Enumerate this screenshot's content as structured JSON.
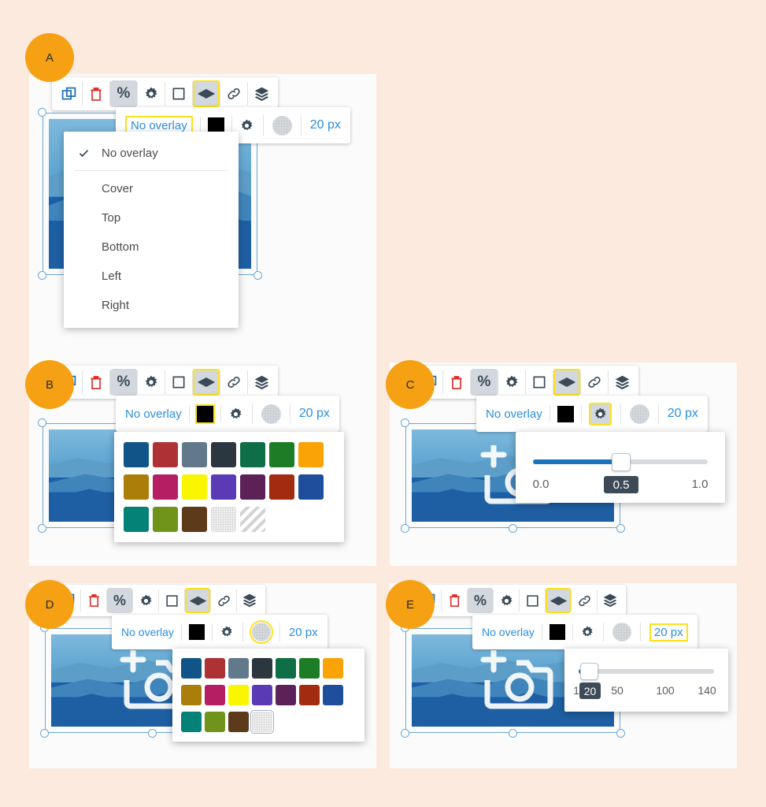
{
  "background_color": "#fdeade",
  "badges": [
    "A",
    "B",
    "C",
    "D",
    "E"
  ],
  "toolbar": {
    "icons": [
      {
        "name": "duplicate-icon",
        "glyph": "duplicate"
      },
      {
        "name": "delete-icon",
        "glyph": "trash"
      },
      {
        "name": "percent-icon",
        "glyph": "percent"
      },
      {
        "name": "settings-gear-icon",
        "glyph": "gear"
      },
      {
        "name": "border-square-icon",
        "glyph": "square"
      },
      {
        "name": "overlay-diamond-icon",
        "glyph": "diamond"
      },
      {
        "name": "link-icon",
        "glyph": "link"
      },
      {
        "name": "layers-icon",
        "glyph": "layers"
      }
    ]
  },
  "overlay_bar": {
    "overlay_label": "No overlay",
    "color_value": "#000000",
    "opacity_icon": "gear-icon",
    "blur_icon": "blur-circle-icon",
    "blur_value": "20 px"
  },
  "overlay_menu": {
    "items": [
      {
        "label": "No overlay",
        "checked": true
      },
      {
        "label": "Cover",
        "checked": false
      },
      {
        "label": "Top",
        "checked": false
      },
      {
        "label": "Bottom",
        "checked": false
      },
      {
        "label": "Left",
        "checked": false
      },
      {
        "label": "Right",
        "checked": false
      }
    ]
  },
  "palette_full": {
    "columns": 7,
    "swatches": [
      {
        "name": "blue-dark",
        "color": "#115588"
      },
      {
        "name": "red-brick",
        "color": "#ae3135"
      },
      {
        "name": "slate-gray",
        "color": "#62798c"
      },
      {
        "name": "charcoal",
        "color": "#2c363f"
      },
      {
        "name": "green-sea",
        "color": "#0e6e46"
      },
      {
        "name": "green-forest",
        "color": "#1d7d27"
      },
      {
        "name": "orange",
        "color": "#faa307"
      },
      {
        "name": "gold-dark",
        "color": "#ab7e09"
      },
      {
        "name": "magenta",
        "color": "#b51e62"
      },
      {
        "name": "yellow",
        "color": "#faf500"
      },
      {
        "name": "purple",
        "color": "#5b3bb5"
      },
      {
        "name": "plum",
        "color": "#5c2157"
      },
      {
        "name": "rust",
        "color": "#a32b0f"
      },
      {
        "name": "blue-royal",
        "color": "#1f4f9c"
      },
      {
        "name": "teal",
        "color": "#048278"
      },
      {
        "name": "olive",
        "color": "#6f9419"
      },
      {
        "name": "brown",
        "color": "#5d3a1a"
      },
      {
        "name": "transparent",
        "color": "transparent"
      },
      {
        "name": "no-color-diagonal",
        "color": "none"
      }
    ]
  },
  "palette_blur": {
    "columns": 7,
    "swatches": [
      {
        "name": "blue-dark",
        "color": "#115588"
      },
      {
        "name": "red-brick",
        "color": "#ae3135"
      },
      {
        "name": "slate-gray",
        "color": "#62798c"
      },
      {
        "name": "charcoal",
        "color": "#2c363f"
      },
      {
        "name": "green-sea",
        "color": "#0e6e46"
      },
      {
        "name": "green-forest",
        "color": "#1d7d27"
      },
      {
        "name": "orange",
        "color": "#faa307"
      },
      {
        "name": "gold-dark",
        "color": "#ab7e09"
      },
      {
        "name": "magenta",
        "color": "#b51e62"
      },
      {
        "name": "yellow",
        "color": "#faf500"
      },
      {
        "name": "purple",
        "color": "#5b3bb5"
      },
      {
        "name": "plum",
        "color": "#5c2157"
      },
      {
        "name": "rust",
        "color": "#a32b0f"
      },
      {
        "name": "blue-royal",
        "color": "#1f4f9c"
      },
      {
        "name": "teal",
        "color": "#048278"
      },
      {
        "name": "olive",
        "color": "#6f9419"
      },
      {
        "name": "brown",
        "color": "#5d3a1a"
      },
      {
        "name": "transparent",
        "color": "transparent"
      }
    ]
  },
  "opacity_slider": {
    "value": "0.5",
    "min_label": "0.0",
    "max_label": "1.0",
    "fill_percent": 50
  },
  "blur_slider": {
    "value": "20",
    "ticks": [
      "1",
      "20",
      "50",
      "100",
      "140"
    ],
    "fill_percent": 4
  }
}
